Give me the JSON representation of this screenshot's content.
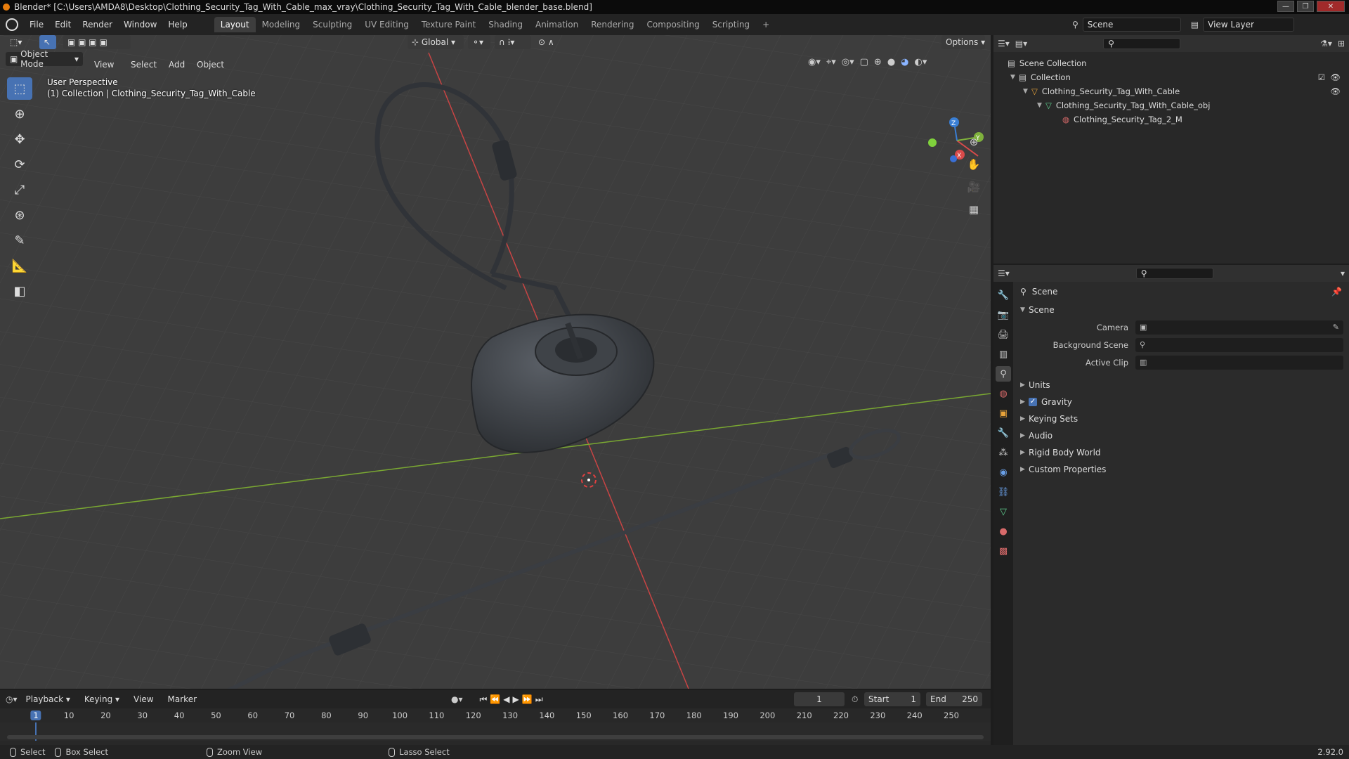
{
  "window": {
    "title": "Blender* [C:\\Users\\AMDA8\\Desktop\\Clothing_Security_Tag_With_Cable_max_vray\\Clothing_Security_Tag_With_Cable_blender_base.blend]"
  },
  "menu": [
    "File",
    "Edit",
    "Render",
    "Window",
    "Help"
  ],
  "workspaces": [
    "Layout",
    "Modeling",
    "Sculpting",
    "UV Editing",
    "Texture Paint",
    "Shading",
    "Animation",
    "Rendering",
    "Compositing",
    "Scripting"
  ],
  "active_workspace": "Layout",
  "scene_selector": {
    "value": "Scene"
  },
  "view_layer_selector": {
    "value": "View Layer"
  },
  "viewport": {
    "transform_orientation": "Global",
    "options_label": "Options",
    "mode": "Object Mode",
    "menus": [
      "View",
      "Select",
      "Add",
      "Object"
    ],
    "overlay_line1": "User Perspective",
    "overlay_line2": "(1) Collection | Clothing_Security_Tag_With_Cable",
    "gizmo": {
      "x": "X",
      "y": "Y",
      "z": "Z"
    },
    "colors": {
      "bg": "#3d3d3d",
      "x_axis": "#d94a4a",
      "y_axis": "#7fb13c",
      "z_axis": "#3a7fd5",
      "grid": "#474747"
    }
  },
  "outliner": {
    "items": [
      {
        "label": "Scene Collection",
        "depth": 0
      },
      {
        "label": "Collection",
        "depth": 1
      },
      {
        "label": "Clothing_Security_Tag_With_Cable",
        "depth": 2
      },
      {
        "label": "Clothing_Security_Tag_With_Cable_obj",
        "depth": 3
      },
      {
        "label": "Clothing_Security_Tag_2_M",
        "depth": 4
      }
    ]
  },
  "properties": {
    "context_title": "Scene",
    "section_title": "Scene",
    "fields": [
      {
        "label": "Camera",
        "value": ""
      },
      {
        "label": "Background Scene",
        "value": ""
      },
      {
        "label": "Active Clip",
        "value": ""
      }
    ],
    "panels": [
      "Units",
      "Gravity",
      "Keying Sets",
      "Audio",
      "Rigid Body World",
      "Custom Properties"
    ],
    "gravity_checked": true
  },
  "timeline": {
    "menus": [
      "Playback",
      "Keying",
      "View",
      "Marker"
    ],
    "current_frame": "1",
    "start_label": "Start",
    "start_value": "1",
    "end_label": "End",
    "end_value": "250",
    "ticks": [
      "1",
      "10",
      "20",
      "30",
      "40",
      "50",
      "60",
      "70",
      "80",
      "90",
      "100",
      "110",
      "120",
      "130",
      "140",
      "150",
      "160",
      "170",
      "180",
      "190",
      "200",
      "210",
      "220",
      "230",
      "240",
      "250"
    ]
  },
  "statusbar": {
    "items": [
      "Select",
      "Box Select",
      "Zoom View",
      "Lasso Select"
    ],
    "version": "2.92.0"
  }
}
